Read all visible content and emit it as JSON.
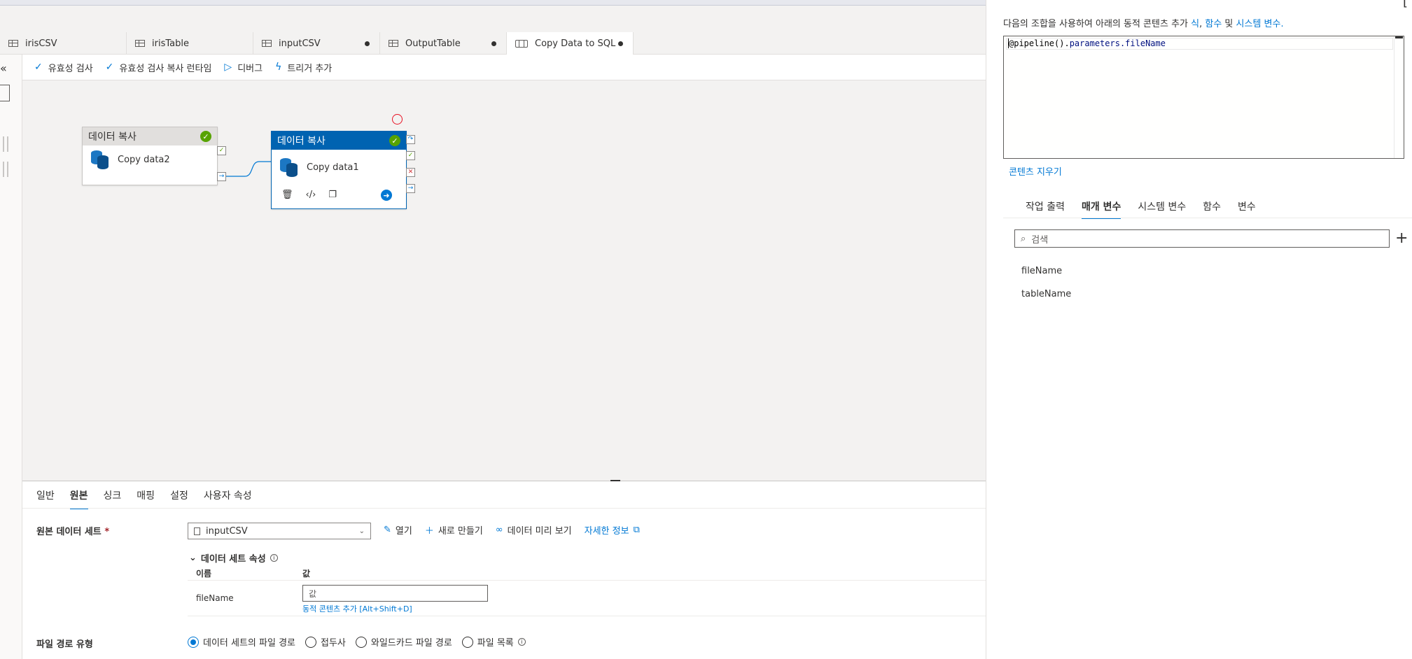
{
  "tabs": [
    {
      "label": "irisCSV",
      "icon": "table-icon",
      "unsaved": false
    },
    {
      "label": "irisTable",
      "icon": "table-icon",
      "unsaved": false
    },
    {
      "label": "inputCSV",
      "icon": "table-icon",
      "unsaved": true
    },
    {
      "label": "OutputTable",
      "icon": "table-icon",
      "unsaved": true
    },
    {
      "label": "Copy Data to SQL",
      "icon": "pipeline-icon",
      "unsaved": true,
      "active": true
    }
  ],
  "leftrail": {
    "collapse": "«"
  },
  "toolbar": {
    "validate": "유효성 검사",
    "validate_copy": "유효성 검사 복사 런타임",
    "debug": "디버그",
    "add_trigger": "트리거 추가"
  },
  "canvas": {
    "node1": {
      "header": "데이터 복사",
      "name": "Copy data2",
      "status": "succeeded"
    },
    "node2": {
      "header": "데이터 복사",
      "name": "Copy data1",
      "status": "succeeded"
    }
  },
  "bottom": {
    "tabs": [
      "일반",
      "원본",
      "싱크",
      "매핑",
      "설정",
      "사용자 속성"
    ],
    "active_tab": "원본",
    "source_dataset_label": "원본 데이터 세트",
    "required_mark": "*",
    "dataset_value": "inputCSV",
    "actions": {
      "open": "열기",
      "new": "새로 만들기",
      "preview": "데이터 미리 보기",
      "more": "자세한 정보"
    },
    "dataset_props_label": "데이터 세트 속성",
    "table": {
      "col_name": "이름",
      "col_value": "값",
      "rows": [
        {
          "name": "fileName",
          "placeholder": "값",
          "dynamic": "동적 콘텐츠 추가 [Alt+Shift+D]"
        }
      ]
    },
    "file_path_type_label": "파일 경로 유형",
    "file_path_options": [
      "데이터 세트의 파일 경로",
      "접두사",
      "와일드카드 파일 경로",
      "파일 목록"
    ],
    "file_path_selected": "데이터 세트의 파일 경로"
  },
  "panel": {
    "desc_prefix": "다음의 조합을 사용하여 아래의 동적 콘텐츠 추가 ",
    "desc_link1": "식",
    "desc_sep1": ", ",
    "desc_link2": "함수",
    "desc_mid": " 및 ",
    "desc_link3": "시스템 변수",
    "desc_end": ".",
    "expr_prefix": "@pipeline().",
    "expr_param": "parameters.fileName",
    "clear": "콘텐츠 지우기",
    "tabs": [
      "작업 출력",
      "매개 변수",
      "시스템 변수",
      "함수",
      "변수"
    ],
    "active_tab": "매개 변수",
    "search_placeholder": "검색",
    "params": [
      "fileName",
      "tableName"
    ]
  }
}
